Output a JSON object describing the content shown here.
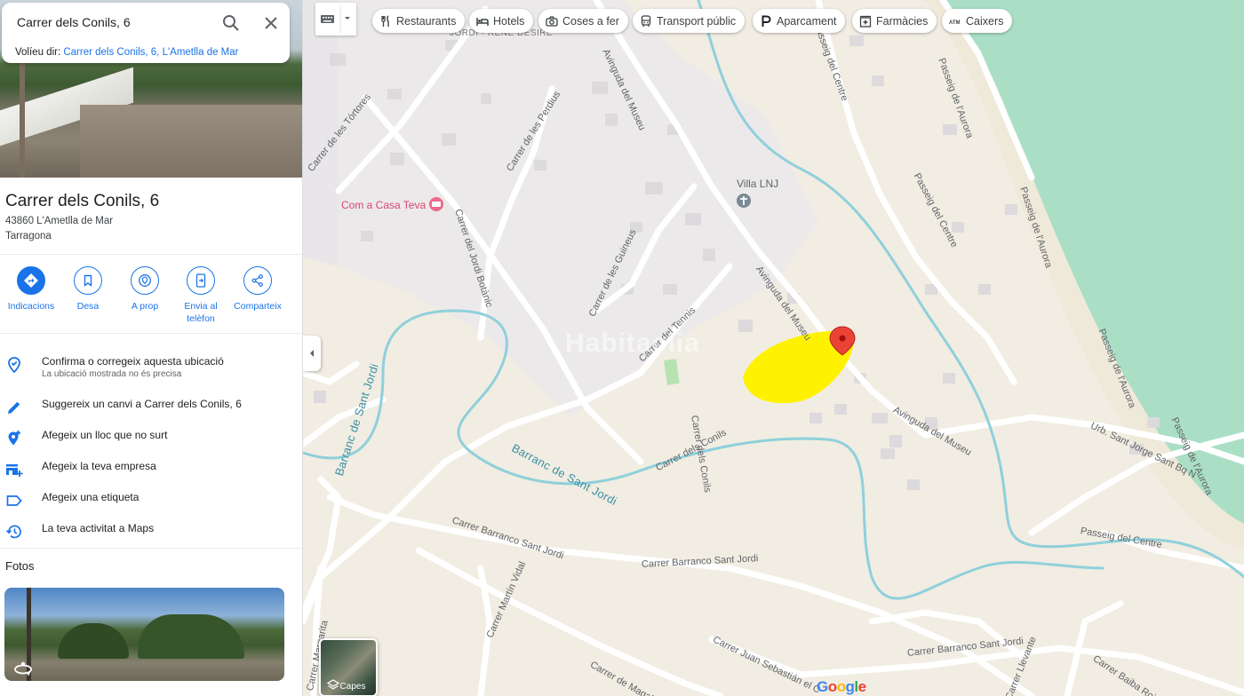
{
  "search": {
    "value": "Carrer dels Conils, 6"
  },
  "did_you_mean": {
    "prefix": "Volíeu dir:",
    "suggestion": "Carrer dels Conils, 6, L'Ametlla de Mar"
  },
  "place": {
    "title": "Carrer dels Conils, 6",
    "address_line1": "43860 L'Ametlla de Mar",
    "address_line2": "Tarragona"
  },
  "actions": [
    {
      "label": "Indicacions",
      "icon": "directions-icon"
    },
    {
      "label": "Desa",
      "icon": "bookmark-icon"
    },
    {
      "label": "A prop",
      "icon": "nearby-icon"
    },
    {
      "label": "Envia al telèfon",
      "icon": "send-to-phone-icon"
    },
    {
      "label": "Comparteix",
      "icon": "share-icon"
    }
  ],
  "menu": [
    {
      "title": "Confirma o corregeix aquesta ubicació",
      "subtitle": "La ubicació mostrada no és precisa",
      "icon": "location-confirm-icon"
    },
    {
      "title": "Suggereix un canvi a Carrer dels Conils, 6",
      "icon": "pencil-icon"
    },
    {
      "title": "Afegeix un lloc que no surt",
      "icon": "add-place-icon"
    },
    {
      "title": "Afegeix la teva empresa",
      "icon": "add-business-icon"
    },
    {
      "title": "Afegeix una etiqueta",
      "icon": "label-icon"
    },
    {
      "title": "La teva activitat a Maps",
      "icon": "history-icon"
    }
  ],
  "photos": {
    "heading": "Fotos"
  },
  "chips": [
    {
      "label": "Restaurants",
      "icon": "restaurant-icon"
    },
    {
      "label": "Hotels",
      "icon": "hotel-icon"
    },
    {
      "label": "Coses a fer",
      "icon": "camera-icon"
    },
    {
      "label": "Transport públic",
      "icon": "transit-icon"
    },
    {
      "label": "Aparcament",
      "icon": "parking-icon"
    },
    {
      "label": "Farmàcies",
      "icon": "pharmacy-icon"
    },
    {
      "label": "Caixers",
      "icon": "atm-icon"
    }
  ],
  "map": {
    "pois": {
      "villa": "Villa LNJ",
      "hotel": "Com a Casa Teva",
      "top_cut": "JORDI - RENÉ DESIRÉ"
    },
    "streets": {
      "tortores": "Carrer de les Tórtores",
      "perdius": "Carrer de les Perdius",
      "museu1": "Avinguda del Museu",
      "museu2": "Avinguda del Museu",
      "museu3": "Avinguda del Museu",
      "centre1": "Passeig del Centre",
      "centre2": "Passeig del Centre",
      "centre3": "Passeig del Centre",
      "aurora1": "Passeig de l'Aurora",
      "aurora2": "Passeig de l'Aurora",
      "aurora3": "Passeig de l'Aurora",
      "aurora4": "Passeig de l'Aurora",
      "jordi_botanic": "Carrer del Jordi Botànic",
      "guineus": "Carrer de les Guineus",
      "tennis": "Carrer del Tennis",
      "conils": "Carrer dels Conils",
      "conils2": "Carrer dels Conils",
      "urb": "Urb. Sant Jorge Sant Bq N",
      "barranco1": "Carrer Barranco Sant Jordi",
      "barranco2": "Carrer Barranco Sant Jordi",
      "barranco3": "Carrer Barranco Sant Jordi",
      "martin": "Carrer Martín Vidal",
      "margarita": "Carrer Margarita",
      "juan": "Carrer Juan Sebastián el C",
      "magallanes": "Carrer de Magallanes",
      "llevante": "Carrer Llevante",
      "baiba": "Carrer Baiba Roja"
    },
    "water": {
      "stream1": "Barranc de Sant Jordi",
      "stream2": "Barranc de Sant Jordi"
    },
    "watermark": "Habitaclia",
    "layers_label": "Capes",
    "google": "Google"
  },
  "colors": {
    "accent": "#1a73e8",
    "highlight": "#fff200",
    "pin": "#ea4335",
    "water": "#8fd0db",
    "sea": "#aadfc5"
  }
}
